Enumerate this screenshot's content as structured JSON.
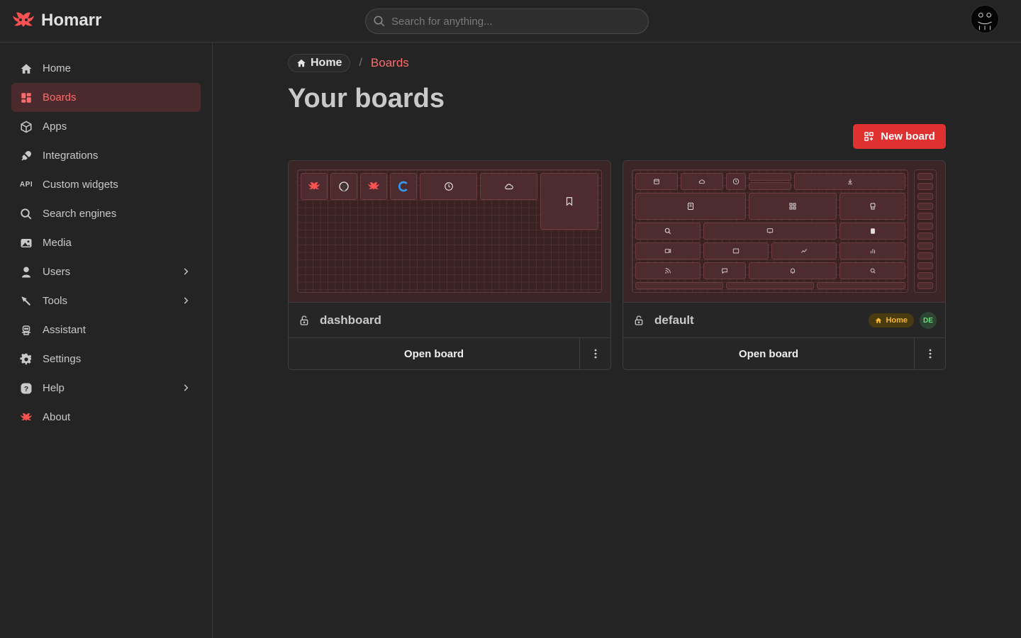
{
  "header": {
    "brand": "Homarr",
    "search_placeholder": "Search for anything..."
  },
  "sidebar": {
    "items": [
      {
        "label": "Home",
        "icon": "home-icon",
        "active": false
      },
      {
        "label": "Boards",
        "icon": "layout-grid-icon",
        "active": true
      },
      {
        "label": "Apps",
        "icon": "box-icon",
        "active": false
      },
      {
        "label": "Integrations",
        "icon": "plug-icon",
        "active": false
      },
      {
        "label": "Custom widgets",
        "icon": "api-icon",
        "active": false
      },
      {
        "label": "Search engines",
        "icon": "search-icon",
        "active": false
      },
      {
        "label": "Media",
        "icon": "photo-icon",
        "active": false
      },
      {
        "label": "Users",
        "icon": "user-icon",
        "active": false,
        "expandable": true
      },
      {
        "label": "Tools",
        "icon": "tool-icon",
        "active": false,
        "expandable": true
      },
      {
        "label": "Assistant",
        "icon": "robot-icon",
        "active": false
      },
      {
        "label": "Settings",
        "icon": "gear-icon",
        "active": false
      },
      {
        "label": "Help",
        "icon": "help-icon",
        "active": false,
        "expandable": true
      },
      {
        "label": "About",
        "icon": "homarr-logo-icon",
        "active": false
      }
    ]
  },
  "breadcrumb": {
    "home": "Home",
    "separator": "/",
    "current": "Boards"
  },
  "page": {
    "title": "Your boards",
    "new_board_label": "New board"
  },
  "boards": [
    {
      "name": "dashboard",
      "open_label": "Open board",
      "badges": []
    },
    {
      "name": "default",
      "open_label": "Open board",
      "badges": [
        {
          "label": "Home",
          "color": "#f2b636"
        },
        {
          "label": "DE",
          "color": "#69db7c"
        }
      ]
    }
  ],
  "colors": {
    "accent": "#e03131",
    "accent_text": "#ff6b6b",
    "background": "#242424"
  },
  "api_icon_text": "API"
}
